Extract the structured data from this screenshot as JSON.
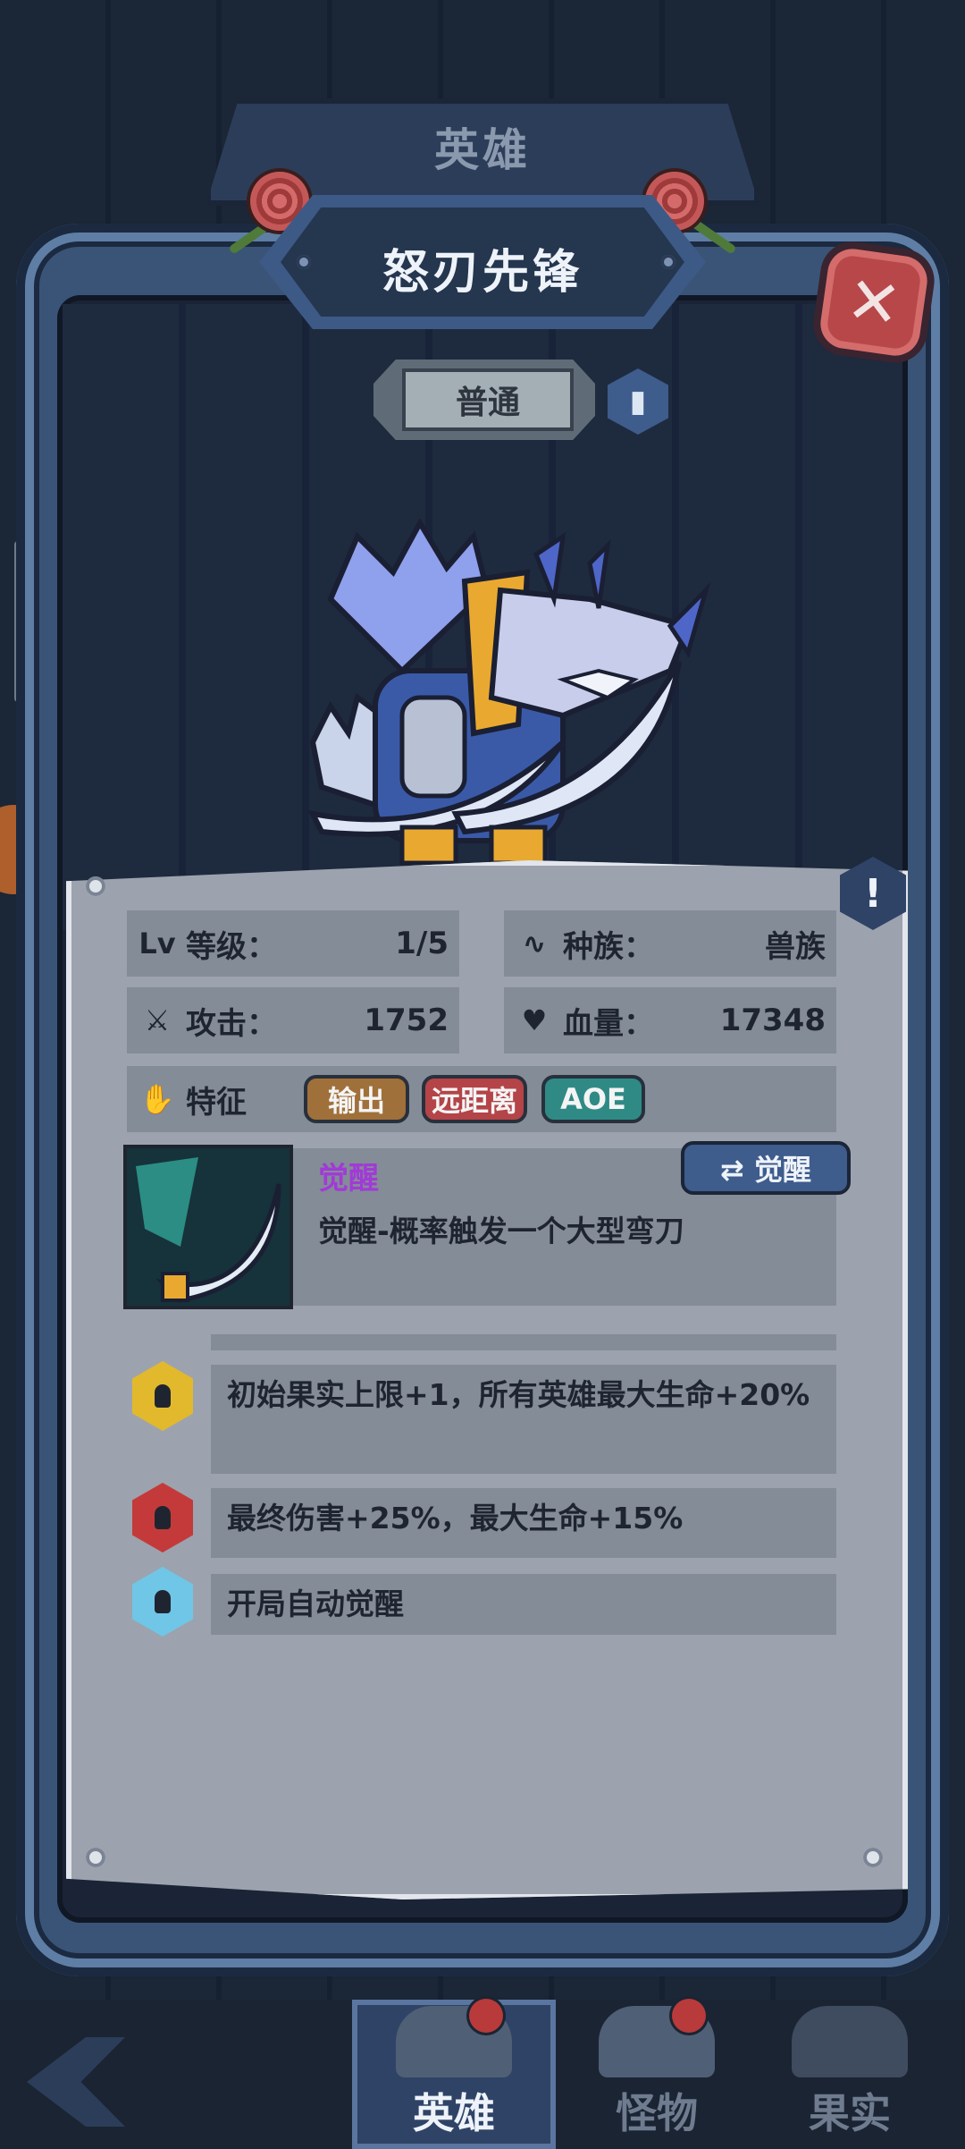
{
  "header": {
    "section_title": "英雄",
    "hero_name": "怒刃先锋",
    "rarity": "普通",
    "close_symbol": "✕",
    "book_icon": "book-icon"
  },
  "stats": {
    "level_label": "等级：",
    "level_value": "1/5",
    "race_label": "种族：",
    "race_value": "兽族",
    "attack_label": "攻击：",
    "attack_value": "1752",
    "hp_label": "血量：",
    "hp_value": "17348",
    "traits_label": "特征",
    "lv_glyph": "Lv"
  },
  "tags": [
    {
      "label": "输出",
      "color": "#a0703a"
    },
    {
      "label": "远距离",
      "color": "#b44448"
    },
    {
      "label": "AOE",
      "color": "#2f8a86"
    }
  ],
  "skill": {
    "title": "觉醒",
    "description": "觉醒-概率触发一个大型弯刀",
    "button": "⇄ 觉醒"
  },
  "upgrades": [
    {
      "text": "初始果实上限+1，所有英雄最大生命+20%",
      "color": "#e2b92c"
    },
    {
      "text": "最终伤害+25%，最大生命+15%",
      "color": "#c43a3a"
    },
    {
      "text": "开局自动觉醒",
      "color": "#6fc6e6"
    }
  ],
  "alert_symbol": "!",
  "nav": {
    "hero": "英雄",
    "monster": "怪物",
    "fruit": "果实"
  },
  "colors": {
    "accent_blue": "#3e5c8c",
    "panel": "#9ca3ae",
    "skill_title": "#a13ad6"
  }
}
